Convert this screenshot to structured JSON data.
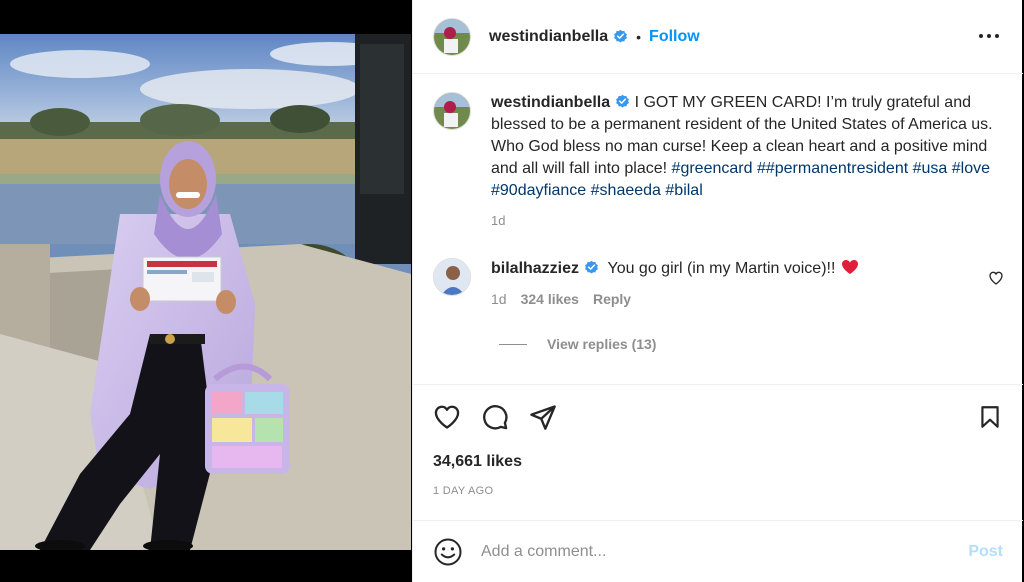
{
  "post": {
    "author": "westindianbella",
    "follow_label": "Follow",
    "dot": "•",
    "more_icon": "more-horizontal-icon"
  },
  "caption": {
    "username": "westindianbella",
    "text_main": "I GOT MY GREEN CARD! I’m truly grateful and blessed to be a permanent resident of the United States of America us. Who God bless no man curse! Keep a clean heart and a positive mind and all will fall into place!",
    "hashtags": [
      "#greencard",
      "##permanentresident",
      "#usa",
      "#love",
      "#90dayfiance",
      "#shaeeda",
      "#bilal"
    ],
    "age": "1d"
  },
  "comment": {
    "username": "bilalhazziez",
    "text": "You go girl (in my Martin voice)!!",
    "age": "1d",
    "likes": "324 likes",
    "reply_label": "Reply",
    "view_replies": "View replies (13)"
  },
  "actions": {
    "likes": "34,661 likes",
    "date": "1 DAY AGO"
  },
  "add_comment": {
    "placeholder": "Add a comment...",
    "post_label": "Post"
  },
  "colors": {
    "accent": "#0095f6",
    "verified": "#3897f0",
    "hashtag": "#00376b",
    "muted": "#8e8e8e",
    "post_disabled": "#b2dffc",
    "heart": "#ed4956"
  }
}
